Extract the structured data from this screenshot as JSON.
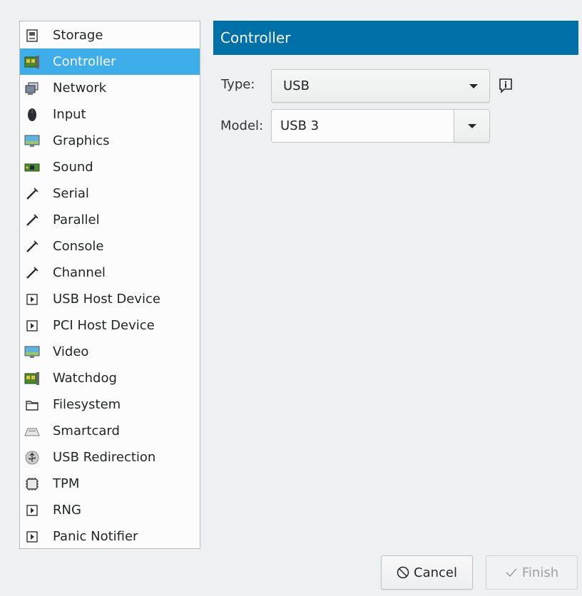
{
  "sidebar": {
    "items": [
      {
        "label": "Storage",
        "icon": "storage-icon"
      },
      {
        "label": "Controller",
        "icon": "controller-icon",
        "selected": true
      },
      {
        "label": "Network",
        "icon": "network-icon"
      },
      {
        "label": "Input",
        "icon": "mouse-icon"
      },
      {
        "label": "Graphics",
        "icon": "monitor-icon"
      },
      {
        "label": "Sound",
        "icon": "sound-card-icon"
      },
      {
        "label": "Serial",
        "icon": "cable-icon"
      },
      {
        "label": "Parallel",
        "icon": "cable-icon"
      },
      {
        "label": "Console",
        "icon": "cable-icon"
      },
      {
        "label": "Channel",
        "icon": "cable-icon"
      },
      {
        "label": "USB Host Device",
        "icon": "device-icon"
      },
      {
        "label": "PCI Host Device",
        "icon": "device-icon"
      },
      {
        "label": "Video",
        "icon": "monitor-icon"
      },
      {
        "label": "Watchdog",
        "icon": "controller-icon"
      },
      {
        "label": "Filesystem",
        "icon": "folder-icon"
      },
      {
        "label": "Smartcard",
        "icon": "smartcard-icon"
      },
      {
        "label": "USB Redirection",
        "icon": "usb-icon"
      },
      {
        "label": "TPM",
        "icon": "chip-icon"
      },
      {
        "label": "RNG",
        "icon": "device-icon"
      },
      {
        "label": "Panic Notifier",
        "icon": "device-icon"
      }
    ]
  },
  "header": {
    "title": "Controller"
  },
  "form": {
    "type_label": "Type:",
    "type_value": "USB",
    "model_label": "Model:",
    "model_value": "USB 3"
  },
  "buttons": {
    "cancel_label": "Cancel",
    "finish_label": "Finish"
  },
  "colors": {
    "selection": "#3daee9",
    "header": "#0071a8",
    "window_bg": "#eff0f1"
  }
}
